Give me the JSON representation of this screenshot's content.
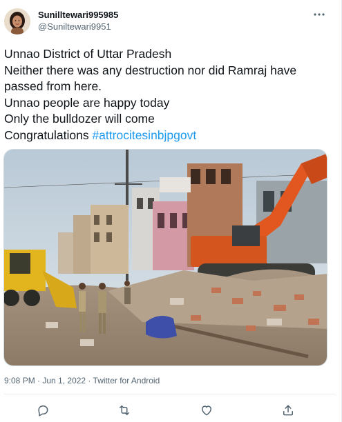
{
  "author": {
    "display_name": "Sunilltewari995985",
    "handle": "@Suniltewari9951"
  },
  "tweet": {
    "lines": [
      "Unnao District of Uttar Pradesh",
      "Neither there was any destruction nor did Ramraj have",
      "passed from here.",
      "Unnao people are happy today",
      "Only the bulldozer will come"
    ],
    "last_line_prefix": "Congratulations ",
    "hashtag": "#attrocitesinbjpgovt"
  },
  "meta": {
    "time": "9:08 PM",
    "separator1": " · ",
    "date": "Jun 1, 2022",
    "separator2": " · ",
    "source": "Twitter for Android"
  },
  "icons": {
    "more": "more-horizontal-icon",
    "reply": "reply-icon",
    "retweet": "retweet-icon",
    "like": "like-icon",
    "share": "share-icon"
  },
  "colors": {
    "hashtag": "#1d9bf0",
    "secondary_text": "#536471",
    "primary_text": "#0f1419"
  }
}
